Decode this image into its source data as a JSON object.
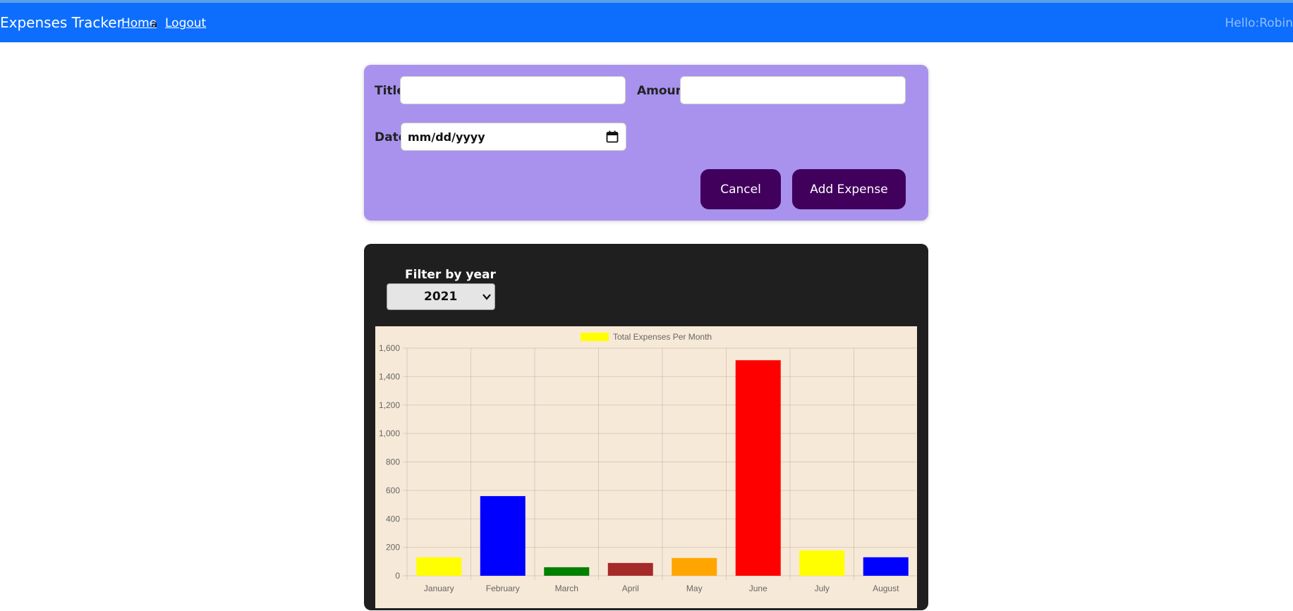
{
  "navbar": {
    "brand": "Expenses Tracker",
    "home": "Home",
    "stray_char": "a",
    "logout": "Logout",
    "greeting": "Hello:Robin"
  },
  "form": {
    "title_label": "Title",
    "title_value": "",
    "amount_label": "Amount",
    "amount_value": "",
    "date_label": "Date",
    "date_placeholder": "mm/dd/yyyy",
    "cancel_label": "Cancel",
    "add_label": "Add Expense"
  },
  "filter": {
    "label": "Filter by year",
    "selected_year": "2021"
  },
  "colors": {
    "navbar": "#0d6efd",
    "form_bg": "#a892ee",
    "button": "#40005c",
    "chart_card": "#1f1f1f",
    "chart_bg": "#f7e9d7"
  },
  "chart_data": {
    "type": "bar",
    "legend": "Total Expenses Per Month",
    "legend_color": "#ffff00",
    "legend_position": "top",
    "categories": [
      "January",
      "February",
      "March",
      "April",
      "May",
      "June",
      "July",
      "August"
    ],
    "values": [
      130,
      560,
      60,
      90,
      125,
      1515,
      178,
      130
    ],
    "colors": [
      "#ffff00",
      "#0000ff",
      "#008000",
      "#a52a2a",
      "#ffa500",
      "#ff0000",
      "#ffff00",
      "#0000ff"
    ],
    "ylim": [
      0,
      1600
    ],
    "yticks": [
      "0",
      "200",
      "400",
      "600",
      "800",
      "1,000",
      "1,200",
      "1,400",
      "1,600"
    ],
    "grid": true
  }
}
